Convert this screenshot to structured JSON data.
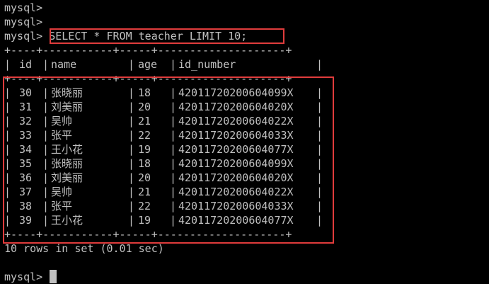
{
  "terminal": {
    "prompt_lines": [
      "mysql>",
      "mysql>"
    ],
    "query_prompt": "mysql>",
    "query": "SELECT * FROM teacher LIMIT 10;",
    "border_line": "+----+-----------+-----+--------------------+",
    "header": [
      "id",
      "name",
      "age",
      "id_number"
    ],
    "rows": [
      {
        "id": "30",
        "name": "张晓丽",
        "age": "18",
        "id_number": "42011720200604099X"
      },
      {
        "id": "31",
        "name": "刘美丽",
        "age": "20",
        "id_number": "42011720200604020X"
      },
      {
        "id": "32",
        "name": "吴帅",
        "age": "21",
        "id_number": "42011720200604022X"
      },
      {
        "id": "33",
        "name": "张平",
        "age": "22",
        "id_number": "42011720200604033X"
      },
      {
        "id": "34",
        "name": "王小花",
        "age": "19",
        "id_number": "42011720200604077X"
      },
      {
        "id": "35",
        "name": "张晓丽",
        "age": "18",
        "id_number": "42011720200604099X"
      },
      {
        "id": "36",
        "name": "刘美丽",
        "age": "20",
        "id_number": "42011720200604020X"
      },
      {
        "id": "37",
        "name": "吴帅",
        "age": "21",
        "id_number": "42011720200604022X"
      },
      {
        "id": "38",
        "name": "张平",
        "age": "22",
        "id_number": "42011720200604033X"
      },
      {
        "id": "39",
        "name": "王小花",
        "age": "19",
        "id_number": "42011720200604077X"
      }
    ],
    "result_summary": "10 rows in set (0.01 sec)",
    "final_prompt": "mysql>"
  },
  "colors": {
    "background": "#000000",
    "text": "#c0c0c0",
    "highlight": "#e03c3c"
  }
}
